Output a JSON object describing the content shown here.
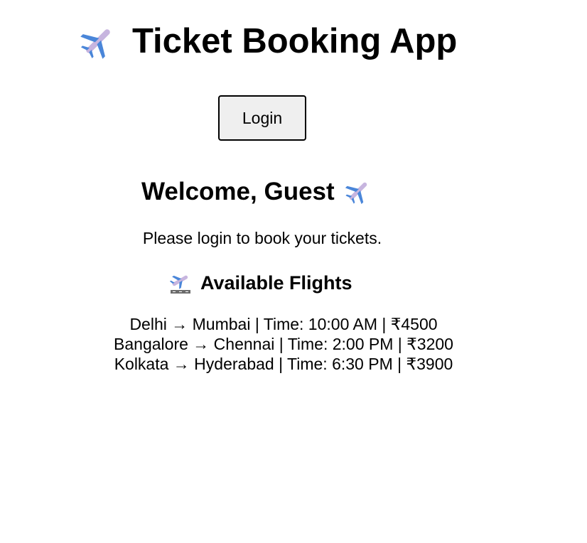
{
  "app": {
    "title": "Ticket Booking App",
    "title_icon": "airplane-icon"
  },
  "auth": {
    "login_label": "Login"
  },
  "welcome": {
    "heading": "Welcome, Guest",
    "icon": "airplane-icon",
    "message": "Please login to book your tickets."
  },
  "flights": {
    "heading": "Available Flights",
    "icon": "airplane-departure-icon",
    "items": [
      "Delhi → Mumbai | Time: 10:00 AM | ₹4500",
      "Bangalore → Chennai | Time: 2:00 PM | ₹3200",
      "Kolkata → Hyderabad | Time: 6:30 PM | ₹3900"
    ]
  },
  "colors": {
    "text": "#000000",
    "button_bg": "#efefef",
    "button_border": "#000000",
    "plane_body": "#c7b5df",
    "plane_wing": "#4a86d9"
  }
}
